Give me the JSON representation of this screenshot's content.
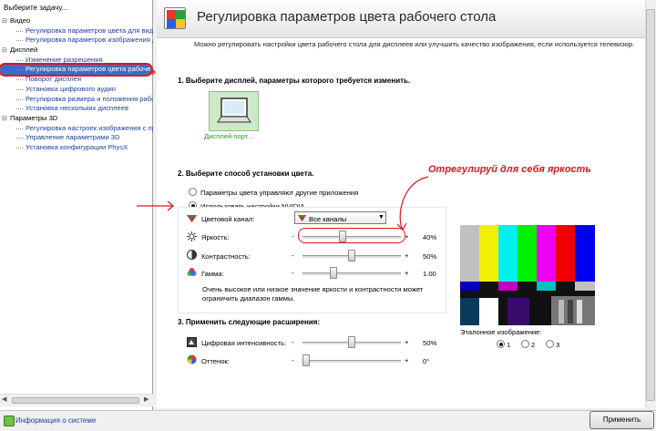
{
  "sidebar": {
    "header": "Выберите задачу...",
    "tree": [
      {
        "type": "cat",
        "label": "Видео"
      },
      {
        "type": "child",
        "label": "Регулировка параметров цвета для видео"
      },
      {
        "type": "child",
        "label": "Регулировка параметров изображения для видео"
      },
      {
        "type": "cat",
        "label": "Дисплей"
      },
      {
        "type": "child",
        "label": "Изменение разрешения"
      },
      {
        "type": "child",
        "label": "Регулировка параметров цвета рабочего стола",
        "selected": true
      },
      {
        "type": "child",
        "label": "Поворот дисплея"
      },
      {
        "type": "child",
        "label": "Установка цифрового аудио"
      },
      {
        "type": "child",
        "label": "Регулировка размера и положения рабочего стола"
      },
      {
        "type": "child",
        "label": "Установка нескольких дисплеев"
      },
      {
        "type": "cat",
        "label": "Параметры 3D"
      },
      {
        "type": "child",
        "label": "Регулировка настроек изображения с просмотром"
      },
      {
        "type": "child",
        "label": "Управление параметрами 3D"
      },
      {
        "type": "child",
        "label": "Установка конфигурации PhysX"
      }
    ]
  },
  "page": {
    "title": "Регулировка параметров цвета рабочего стола",
    "description": "Можно регулировать настройки цвета рабочего стола для дисплеев или улучшить качество изображения, если используется телевизор.",
    "section1": "1. Выберите дисплей, параметры которого требуется изменить.",
    "display_label": "Дисплей порт…",
    "section2": "2. Выберите способ установки цвета.",
    "radio_other": "Параметры цвета управляют другие приложения",
    "radio_nvidia": "Использовать настройки NVIDIA",
    "channel_label": "Цветовой канал:",
    "channel_value": "Все каналы",
    "brightness_label": "Яркость:",
    "brightness_value": "40%",
    "contrast_label": "Контрастность:",
    "contrast_value": "50%",
    "gamma_label": "Гамма:",
    "gamma_value": "1.00",
    "minus": "-",
    "plus": "+",
    "note": "Очень высокое или низкое значение яркости и контрастности может ограничить диапазон гаммы.",
    "section3": "3. Применить следующие расширения:",
    "digital_label": "Цифровая интенсивность:",
    "digital_value": "50%",
    "hue_label": "Оттенок:",
    "hue_value": "0°",
    "ref_label": "Эталонное изображение:",
    "ref_options": [
      "1",
      "2",
      "3"
    ]
  },
  "annotation": "Отрегулируй для себя яркость",
  "footer": {
    "info_link": "Информация о системе",
    "apply": "Применить"
  },
  "sliders": {
    "brightness": 0.4,
    "contrast": 0.5,
    "gamma": 0.3,
    "digital": 0.5,
    "hue": 0.0
  },
  "colors": {
    "accent_red": "#e0141e",
    "link_blue": "#1e3f9f",
    "selection_blue": "#3c6cc8",
    "display_green": "#2a9a1c"
  }
}
